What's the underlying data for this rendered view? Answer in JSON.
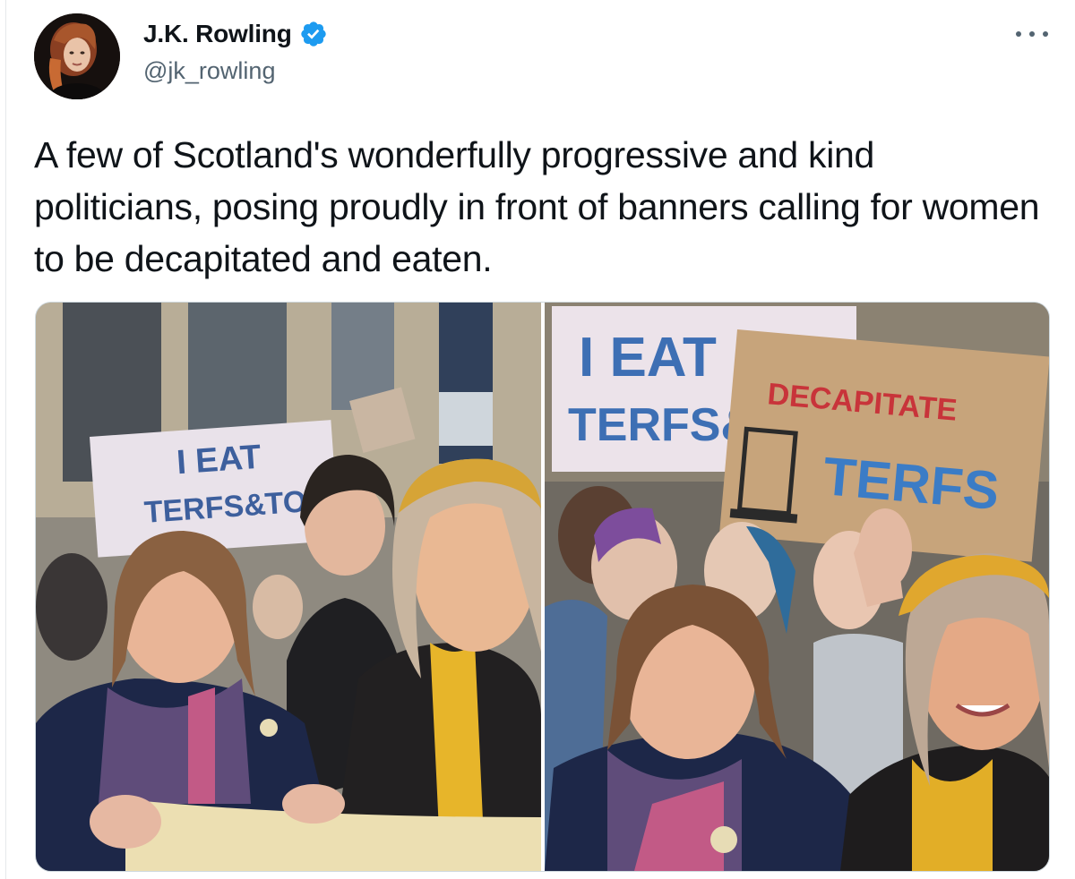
{
  "user": {
    "display_name": "J.K. Rowling",
    "handle": "@jk_rowling",
    "verified": true
  },
  "tweet": {
    "text": "A few of Scotland's wonderfully progressive and kind politicians, posing proudly in front of banners calling for women to be decapitated and eaten."
  },
  "media": {
    "left_photo": {
      "signs": [
        "I EAT",
        "TERFS&",
        "TORI"
      ]
    },
    "right_photo": {
      "signs": [
        "I EAT",
        "TERFS&",
        "DECAPITATE",
        "TERFS"
      ]
    }
  },
  "colors": {
    "text_primary": "#0f1419",
    "text_secondary": "#536471",
    "verified_blue": "#1d9bf0",
    "border": "#cfd9de"
  }
}
